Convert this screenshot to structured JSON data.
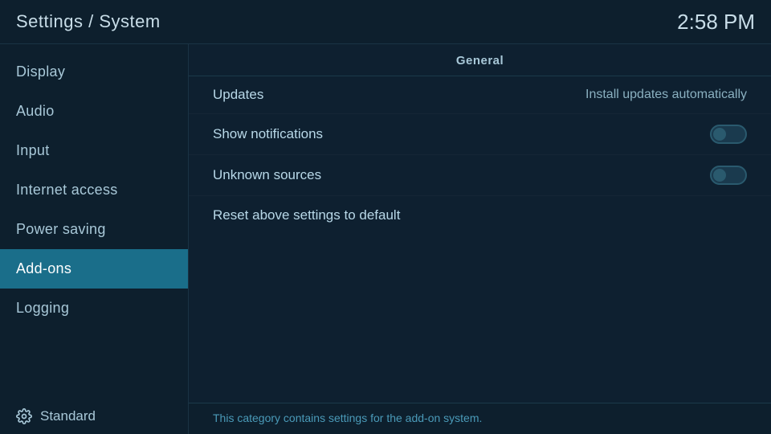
{
  "header": {
    "title": "Settings / System",
    "time": "2:58 PM"
  },
  "sidebar": {
    "items": [
      {
        "id": "display",
        "label": "Display",
        "active": false
      },
      {
        "id": "audio",
        "label": "Audio",
        "active": false
      },
      {
        "id": "input",
        "label": "Input",
        "active": false
      },
      {
        "id": "internet-access",
        "label": "Internet access",
        "active": false
      },
      {
        "id": "power-saving",
        "label": "Power saving",
        "active": false
      },
      {
        "id": "add-ons",
        "label": "Add-ons",
        "active": true
      },
      {
        "id": "logging",
        "label": "Logging",
        "active": false
      }
    ],
    "bottom_label": "Standard"
  },
  "content": {
    "section_header": "General",
    "rows": [
      {
        "id": "updates",
        "label": "Updates",
        "value": "Install updates automatically",
        "has_toggle": false
      },
      {
        "id": "show-notifications",
        "label": "Show notifications",
        "value": "",
        "has_toggle": true
      },
      {
        "id": "unknown-sources",
        "label": "Unknown sources",
        "value": "",
        "has_toggle": true
      }
    ],
    "reset_label": "Reset above settings to default",
    "footer_text": "This category contains settings for the add-on system."
  }
}
